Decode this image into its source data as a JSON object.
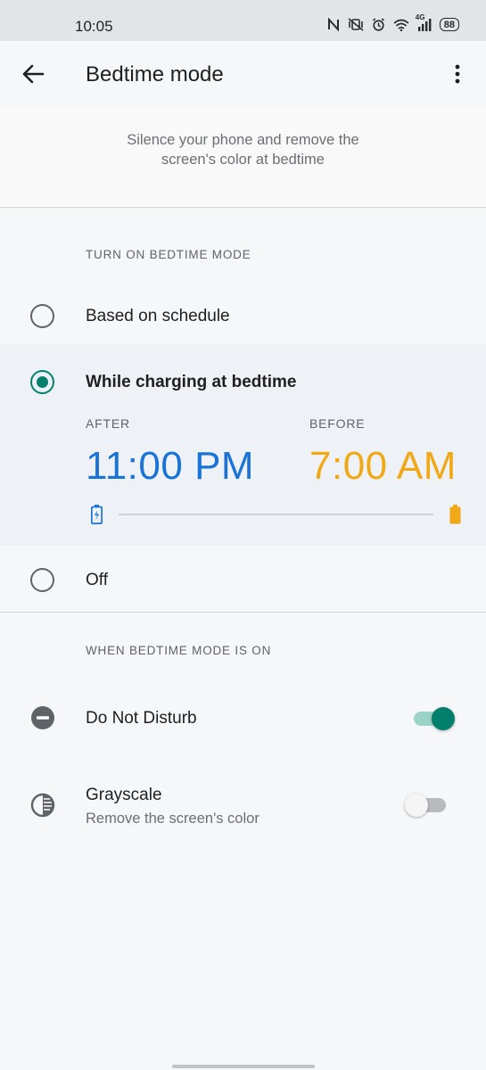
{
  "status_bar": {
    "time": "10:05",
    "battery": "88",
    "network_label": "4G",
    "icons": [
      "nfc-icon",
      "vibrate-off-icon",
      "alarm-icon",
      "wifi-icon",
      "signal-icon",
      "battery-icon"
    ]
  },
  "header": {
    "title": "Bedtime mode",
    "back_icon": "arrow-left-icon",
    "menu_icon": "more-vert-icon"
  },
  "intro": {
    "line1": "Silence your phone and remove the",
    "line2": "screen's color at bedtime"
  },
  "turn_on_section": {
    "header": "TURN ON BEDTIME MODE",
    "options": [
      {
        "label": "Based on schedule",
        "selected": false
      },
      {
        "label": "While charging at bedtime",
        "selected": true
      },
      {
        "label": "Off",
        "selected": false
      }
    ],
    "charging": {
      "after_label": "AFTER",
      "after_time": "11:00 PM",
      "before_label": "BEFORE",
      "before_time": "7:00 AM",
      "start_icon": "battery-charging-icon",
      "end_icon": "battery-full-icon"
    }
  },
  "when_on_section": {
    "header": "WHEN BEDTIME MODE IS ON",
    "items": [
      {
        "title": "Do Not Disturb",
        "subtitle": "",
        "icon": "do-not-disturb-icon",
        "enabled": true
      },
      {
        "title": "Grayscale",
        "subtitle": "Remove the screen's color",
        "icon": "grayscale-icon",
        "enabled": false
      }
    ]
  },
  "colors": {
    "accent": "#00806c",
    "after_time": "#1a73d6",
    "before_time": "#f0a817",
    "background": "#f6f7f9"
  }
}
